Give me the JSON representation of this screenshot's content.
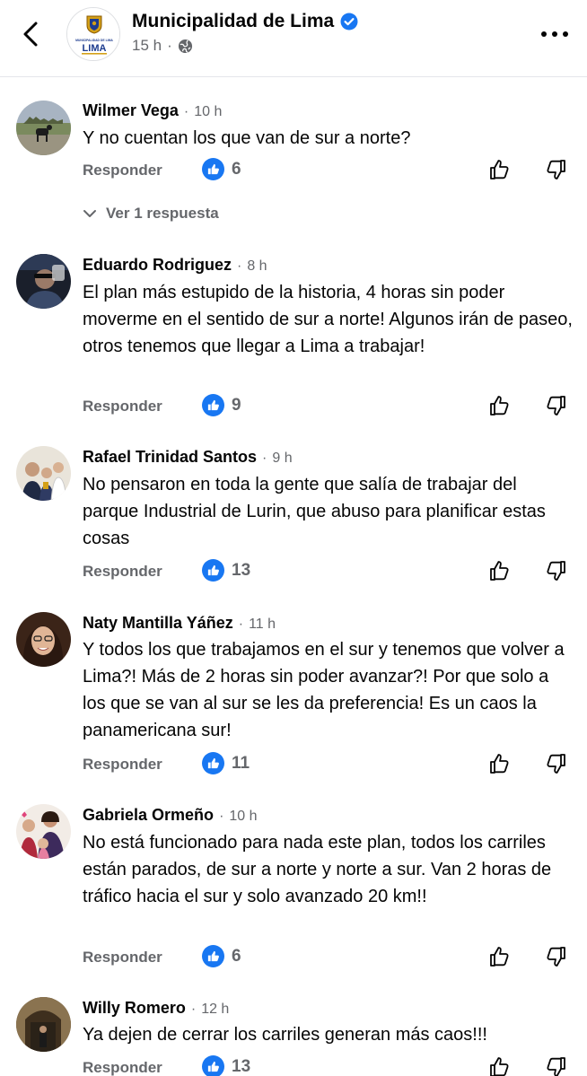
{
  "header": {
    "page_name": "Municipalidad de Lima",
    "page_logo_text": "MUNICIPALIDAD DE LIMA",
    "page_logo_short": "LIMA",
    "time": "15 h",
    "separator": "·",
    "icons": {
      "back": "chevron-left-icon",
      "verified": "verified-badge-icon",
      "audience": "globe-icon",
      "more": "more-dots-icon"
    }
  },
  "labels": {
    "reply": "Responder",
    "view_replies": "Ver 1 respuesta",
    "separator": "·"
  },
  "colors": {
    "accent": "#1877f2",
    "secondary_text": "#65676b",
    "primary_text": "#050505"
  },
  "comments": [
    {
      "author": "Wilmer Vega",
      "time": "10 h",
      "text": "Y no cuentan los que van de sur a norte?",
      "likes": "6"
    },
    {
      "author": "Eduardo Rodriguez",
      "time": "8 h",
      "text": "El plan más estupido de la historia, 4 horas sin poder moverme en el sentido de sur a norte! Algunos irán de paseo, otros tenemos que llegar a Lima a trabajar!",
      "likes": "9"
    },
    {
      "author": "Rafael Trinidad Santos",
      "time": "9 h",
      "text": "No pensaron en toda la gente que salía de trabajar del parque Industrial de Lurin, que abuso para planificar estas cosas",
      "likes": "13"
    },
    {
      "author": "Naty Mantilla Yáñez",
      "time": "11 h",
      "text": "Y todos los que trabajamos en el sur y tenemos que volver a Lima?! Más de 2 horas sin poder avanzar?! Por que solo a los que se van al sur se les da preferencia! Es un caos la panamericana sur!",
      "likes": "11"
    },
    {
      "author": "Gabriela Ormeño",
      "time": "10 h",
      "text": "No está funcionado para nada este plan, todos los carriles están parados, de sur a norte y norte a sur. Van 2 horas de tráfico hacia el sur y solo avanzado 20 km!!",
      "likes": "6"
    },
    {
      "author": "Willy Romero",
      "time": "12 h",
      "text": "Ya dejen de cerrar los carriles generan más caos!!!",
      "likes": "13"
    }
  ]
}
